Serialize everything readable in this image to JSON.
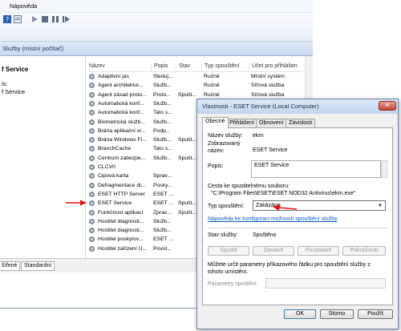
{
  "menu": {
    "help": "Nápověda"
  },
  "header": {
    "title": "Služby (místní počítač)"
  },
  "left_pane": {
    "line1": "f Service",
    "line2": "is:",
    "line3": "f Service"
  },
  "columns": {
    "name": "Název",
    "description": "Popis",
    "state": "Stav",
    "startup": "Typ spouštění",
    "logon": "Účet pro přihlášen"
  },
  "services": [
    {
      "name": "Adaptivní jas",
      "desc": "Sleduj...",
      "state": "",
      "startup": "Ručně",
      "logon": "Místní systém"
    },
    {
      "name": "Agent architektur...",
      "desc": "Služb...",
      "state": "",
      "startup": "Ručně",
      "logon": "Síťová služba"
    },
    {
      "name": "Agent zásad proto...",
      "desc": "Proto...",
      "state": "Spušt...",
      "startup": "Ručně",
      "logon": "Síťová služba"
    },
    {
      "name": "Automatická konf...",
      "desc": "Služb...",
      "state": "",
      "startup": "",
      "logon": ""
    },
    {
      "name": "Automatická konf...",
      "desc": "Tato s...",
      "state": "",
      "startup": "",
      "logon": ""
    },
    {
      "name": "Biometrická služb...",
      "desc": "Služb...",
      "state": "",
      "startup": "",
      "logon": ""
    },
    {
      "name": "Brána aplikační vr...",
      "desc": "Podp...",
      "state": "",
      "startup": "",
      "logon": ""
    },
    {
      "name": "Brána Windows Fi...",
      "desc": "Služb...",
      "state": "Spušt...",
      "startup": "",
      "logon": ""
    },
    {
      "name": "BranchCache",
      "desc": "Tato s...",
      "state": "",
      "startup": "",
      "logon": ""
    },
    {
      "name": "Centrum zabezpe...",
      "desc": "Služb...",
      "state": "Spušt...",
      "startup": "",
      "logon": ""
    },
    {
      "name": "CLCV0",
      "desc": "",
      "state": "",
      "startup": "",
      "logon": ""
    },
    {
      "name": "Čipová karta",
      "desc": "Sprav...",
      "state": "",
      "startup": "",
      "logon": ""
    },
    {
      "name": "Defragmentace di...",
      "desc": "Posky...",
      "state": "",
      "startup": "",
      "logon": ""
    },
    {
      "name": "ESET HTTP Server",
      "desc": "ESET ...",
      "state": "",
      "startup": "",
      "logon": ""
    },
    {
      "name": "ESET Service",
      "desc": "ESET ...",
      "state": "Spušt...",
      "startup": "",
      "logon": ""
    },
    {
      "name": "Funkčnost aplikací",
      "desc": "Zprac...",
      "state": "Spušt...",
      "startup": "",
      "logon": ""
    },
    {
      "name": "Hostitel diagnosti...",
      "desc": "Služb...",
      "state": "",
      "startup": "",
      "logon": ""
    },
    {
      "name": "Hostitel diagnosti...",
      "desc": "Služb...",
      "state": "",
      "startup": "",
      "logon": ""
    },
    {
      "name": "Hostitel poskytov...",
      "desc": "ESET ...",
      "state": "",
      "startup": "",
      "logon": ""
    },
    {
      "name": "Hostitel zařízení U...",
      "desc": "Povol...",
      "state": "",
      "startup": "",
      "logon": ""
    }
  ],
  "view_tabs": {
    "extended": "šířené",
    "standard": "Standardní"
  },
  "dialog": {
    "title": "Vlastnosti - ESET Service (Local Computer)",
    "close": "✕",
    "tabs": [
      "Obecné",
      "Přihlášení",
      "Obnovení",
      "Závislosti"
    ],
    "service_name_label": "Název služby:",
    "service_name_value": "ekrn",
    "display_name_label_1": "Zobrazovaný",
    "display_name_label_2": "název:",
    "display_name_value": "ESET Service",
    "description_label": "Popis:",
    "description_value": "ESET Service",
    "path_label": "Cesta ke spustitelnému souboru:",
    "path_value": "\"C:\\Program Files\\ESET\\ESET NOD32 Antivirus\\ekrn.exe\"",
    "startup_label": "Typ spouštění:",
    "startup_value": "Zakázáno",
    "help_link": "Nápověda ke konfiguraci možností spouštění služby",
    "status_label": "Stav služby:",
    "status_value": "Spuštěno",
    "btn_start": "Spustit",
    "btn_stop": "Zastavit",
    "btn_pause": "Pozastavit",
    "btn_resume": "Pokračovat",
    "params_info": "Můžete určit parametry příkazového řádku pro spouštění služby z tohoto umístění.",
    "params_label": "Parametry spuštění:",
    "btn_ok": "OK",
    "btn_cancel": "Storno",
    "btn_apply": "Použít"
  }
}
